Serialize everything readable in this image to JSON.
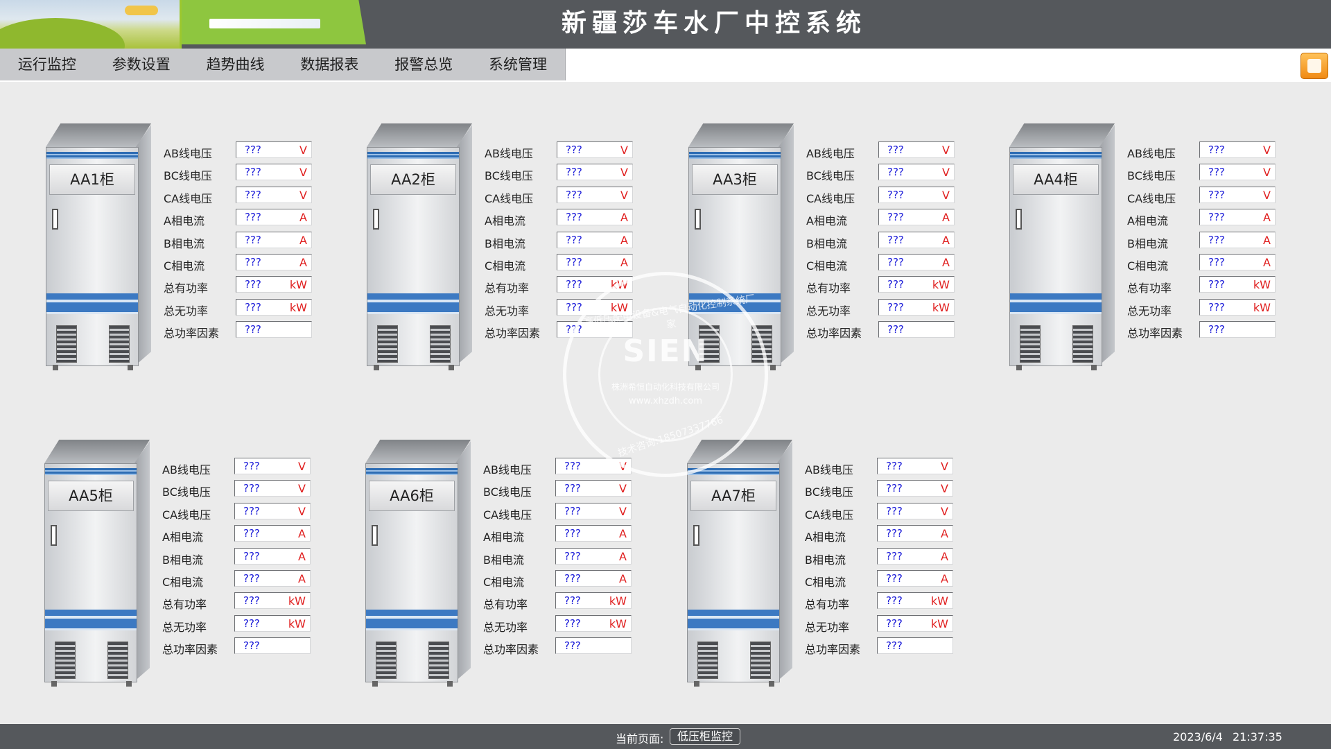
{
  "header": {
    "title": "新疆莎车水厂中控系统"
  },
  "menu": [
    {
      "label": "运行监控"
    },
    {
      "label": "参数设置"
    },
    {
      "label": "趋势曲线"
    },
    {
      "label": "数据报表"
    },
    {
      "label": "报警总览"
    },
    {
      "label": "系统管理"
    }
  ],
  "home_button": {
    "icon": "home-icon"
  },
  "row_labels": [
    "AB线电压",
    "BC线电压",
    "CA线电压",
    "A相电流",
    "B相电流",
    "C相电流",
    "总有功率",
    "总无功率",
    "总功率因素"
  ],
  "row_units": [
    "V",
    "V",
    "V",
    "A",
    "A",
    "A",
    "kW",
    "kW",
    ""
  ],
  "placeholder_value": "???",
  "cabinets": [
    {
      "name": "AA1柜",
      "values": [
        "???",
        "???",
        "???",
        "???",
        "???",
        "???",
        "???",
        "???",
        "???"
      ]
    },
    {
      "name": "AA2柜",
      "values": [
        "???",
        "???",
        "???",
        "???",
        "???",
        "???",
        "???",
        "???",
        "???"
      ]
    },
    {
      "name": "AA3柜",
      "values": [
        "???",
        "???",
        "???",
        "???",
        "???",
        "???",
        "???",
        "???",
        "???"
      ]
    },
    {
      "name": "AA4柜",
      "values": [
        "???",
        "???",
        "???",
        "???",
        "???",
        "???",
        "???",
        "???",
        "???"
      ]
    },
    {
      "name": "AA5柜",
      "values": [
        "???",
        "???",
        "???",
        "???",
        "???",
        "???",
        "???",
        "???",
        "???"
      ]
    },
    {
      "name": "AA6柜",
      "values": [
        "???",
        "???",
        "???",
        "???",
        "???",
        "???",
        "???",
        "???",
        "???"
      ]
    },
    {
      "name": "AA7柜",
      "values": [
        "???",
        "???",
        "???",
        "???",
        "???",
        "???",
        "???",
        "???",
        "???"
      ]
    }
  ],
  "watermark": {
    "brand": "SIEN",
    "ring_top": "高低压配电设备&电气自动化控制系统厂家",
    "company": "株洲希恒自动化科技有限公司",
    "site": "www.xhzdh.com",
    "ring_bottom": "技术咨询:18507337766"
  },
  "footer": {
    "page_label": "当前页面:",
    "page_value": "低压柜监控",
    "date": "2023/6/4",
    "time": "21:37:35"
  },
  "colors": {
    "header_bg": "#55585c",
    "accent_green": "#8ec63f",
    "value_blue": "#1a1ad8",
    "unit_red": "#e01f1f"
  }
}
